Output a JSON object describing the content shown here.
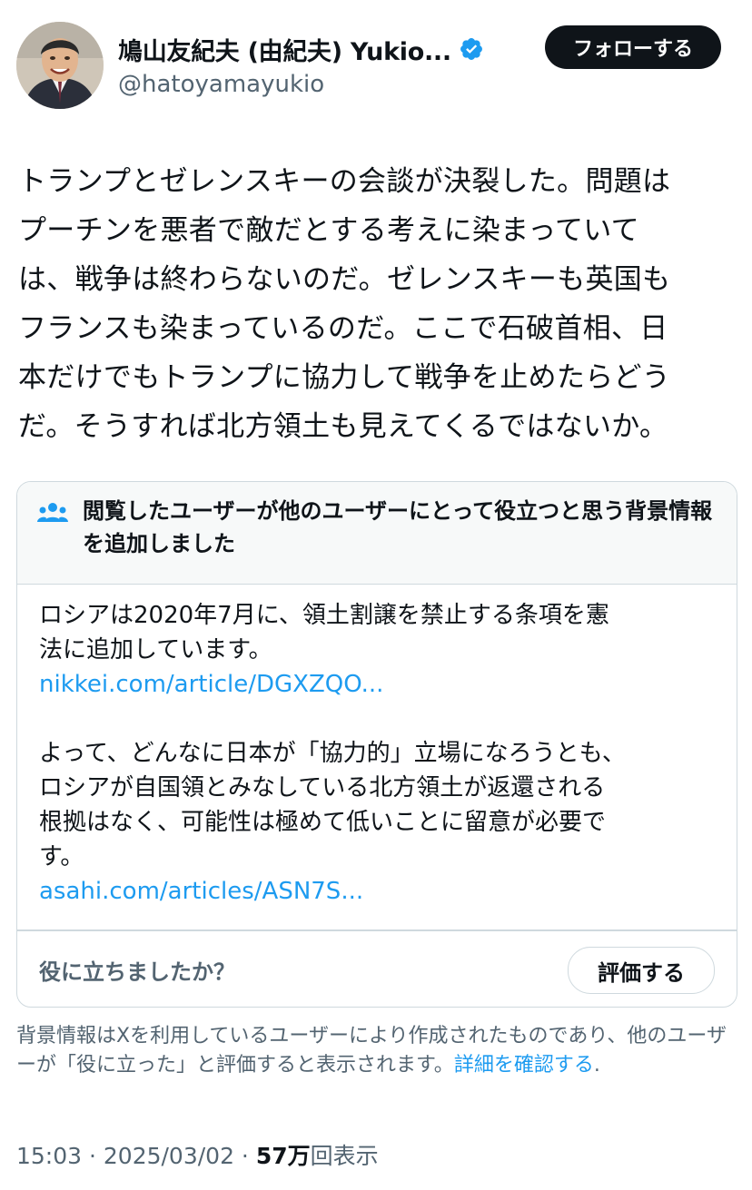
{
  "author": {
    "display_name": "鳩山友紀夫 (由紀夫) Yukio...",
    "handle": "@hatoyamayukio",
    "verified": true
  },
  "follow_button_label": "フォローする",
  "tweet": {
    "lines": [
      "トランプとゼレンスキーの会談が決裂した。問題は",
      "プーチンを悪者で敵だとする考えに染まっていて",
      "は、戦争は終わらないのだ。ゼレンスキーも英国も",
      "フランスも染まっているのだ。ここで石破首相、日",
      "本だけでもトランプに協力して戦争を止めたらどう",
      "だ。そうすれば北方領土も見えてくるではないか。"
    ]
  },
  "community_note": {
    "title": "閲覧したユーザーが他のユーザーにとって役立つと思う背景情報を追加しました",
    "paragraph1_lines": [
      "ロシアは2020年7月に、領土割譲を禁止する条項を憲",
      "法に追加しています。"
    ],
    "link1": "nikkei.com/article/DGXZQO...",
    "paragraph2_lines": [
      "よって、どんなに日本が「協力的」立場になろうとも、",
      "ロシアが自国領とみなしている北方領土が返還される",
      "根拠はなく、可能性は極めて低いことに留意が必要で",
      "す。"
    ],
    "link2": "asahi.com/articles/ASN7S...",
    "helpful_question": "役に立ちましたか？",
    "rate_button_label": "評価する"
  },
  "disclaimer": {
    "text": "背景情報はXを利用しているユーザーにより作成されたものであり、他のユーザーが「役に立った」と評価すると表示されます。",
    "link_label": "詳細を確認する",
    "trailing": "."
  },
  "meta": {
    "time": "15:03",
    "separator": " · ",
    "date": "2025/03/02",
    "views_count": "57万",
    "views_label": "回表示"
  },
  "colors": {
    "text": "#0f1419",
    "secondary": "#536471",
    "link": "#1d9bf0",
    "verified_badge": "#1d9bf0",
    "border": "#cfd9de"
  }
}
